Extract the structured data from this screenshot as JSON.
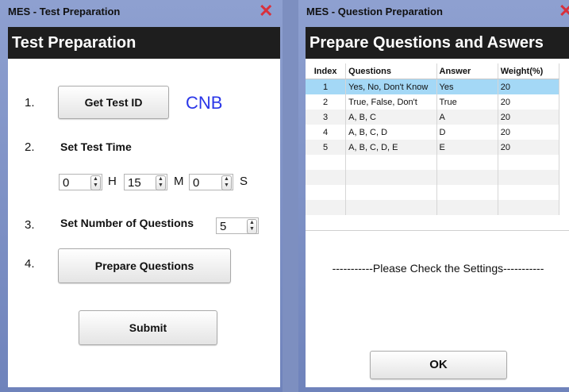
{
  "test_window": {
    "title": "MES - Test Preparation",
    "header": "Test Preparation",
    "steps": [
      {
        "number": "1."
      },
      {
        "number": "2.",
        "label": "Set Test Time"
      },
      {
        "number": "3.",
        "label": "Set Number of Questions"
      },
      {
        "number": "4."
      }
    ],
    "get_test_id_button": "Get Test ID",
    "test_id_value": "CNB",
    "time": {
      "hours": "0",
      "hours_unit": "H",
      "minutes": "15",
      "minutes_unit": "M",
      "seconds": "0",
      "seconds_unit": "S"
    },
    "num_questions": "5",
    "prepare_questions_button": "Prepare Questions",
    "submit_button": "Submit"
  },
  "question_window": {
    "title": "MES - Question Preparation",
    "header": "Prepare Questions and Aswers",
    "columns": [
      "Index",
      "Questions",
      "Answer",
      "Weight(%)"
    ],
    "rows": [
      {
        "index": "1",
        "question": "Yes, No, Don't Know",
        "answer": "Yes",
        "weight": "20"
      },
      {
        "index": "2",
        "question": "True, False, Don't",
        "answer": "True",
        "weight": "20"
      },
      {
        "index": "3",
        "question": "A, B, C",
        "answer": "A",
        "weight": "20"
      },
      {
        "index": "4",
        "question": "A, B, C, D",
        "answer": "D",
        "weight": "20"
      },
      {
        "index": "5",
        "question": "A, B, C, D, E",
        "answer": "E",
        "weight": "20"
      }
    ],
    "status_message": "-----------Please Check the Settings-----------",
    "ok_button": "OK"
  },
  "colors": {
    "accent_blue": "#2a36e8",
    "selected_row": "#a4d8f6",
    "close_red": "#d9303b",
    "header_bg": "#1e1e1e"
  },
  "icons": {
    "close": "close-x-icon",
    "spinner": "spinner-arrows-icon"
  }
}
